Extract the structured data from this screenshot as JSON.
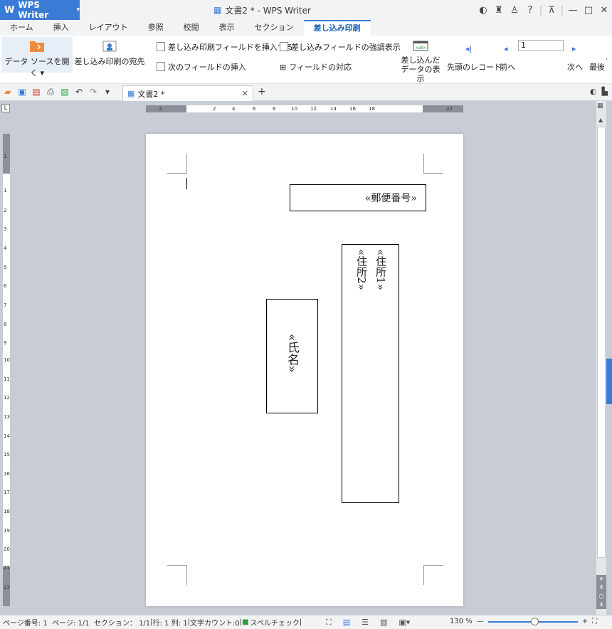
{
  "app": {
    "name": "WPS Writer",
    "title": "文書2 * - WPS Writer"
  },
  "tabs": [
    {
      "label": "ホーム"
    },
    {
      "label": "挿入"
    },
    {
      "label": "レイアウト"
    },
    {
      "label": "参照"
    },
    {
      "label": "校閲"
    },
    {
      "label": "表示"
    },
    {
      "label": "セクション"
    },
    {
      "label": "差し込み印刷"
    }
  ],
  "active_tab": "差し込み印刷",
  "ribbon": {
    "open_source": "データ ソースを開く",
    "recipients": "差し込み印刷の宛先",
    "insert_field": "差し込み印刷フィールドを挿入する",
    "highlight_field": "差し込みフィールドの強調表示",
    "next_field": "次のフィールドの挿入",
    "field_match": "フィールドの対応",
    "view_merged_1": "差し込んだ",
    "view_merged_2": "データの表示",
    "first_record": "先頭のレコード",
    "prev": "前へ",
    "record_value": "1",
    "next": "次へ",
    "last": "最後"
  },
  "doc_tab": {
    "label": "文書2 *"
  },
  "ruler": {
    "h_ticks": [
      "2",
      "2",
      "4",
      "6",
      "8",
      "10",
      "12",
      "14",
      "16",
      "18",
      "22"
    ],
    "v_ticks": [
      "1",
      "1",
      "2",
      "3",
      "4",
      "5",
      "6",
      "7",
      "8",
      "9",
      "10",
      "11",
      "12",
      "13",
      "14",
      "15",
      "16",
      "17",
      "18",
      "19",
      "20",
      "21",
      "22"
    ]
  },
  "document": {
    "zip_field": "«郵便番号»",
    "address_field_1": "«住所1»",
    "address_field_2": "«住所2»",
    "name_field": "«氏名»"
  },
  "status": {
    "page_num": "ページ番号: 1",
    "pages": "ページ: 1/1",
    "section": "セクション： 1/1",
    "row": "行: 1",
    "col": "列: 1",
    "char_count": "文字カウント:0",
    "spell": "スペルチェック",
    "zoom": "130 %"
  },
  "colors": {
    "accent": "#3a7bd5",
    "tab_active_text": "#1a5fb4"
  }
}
